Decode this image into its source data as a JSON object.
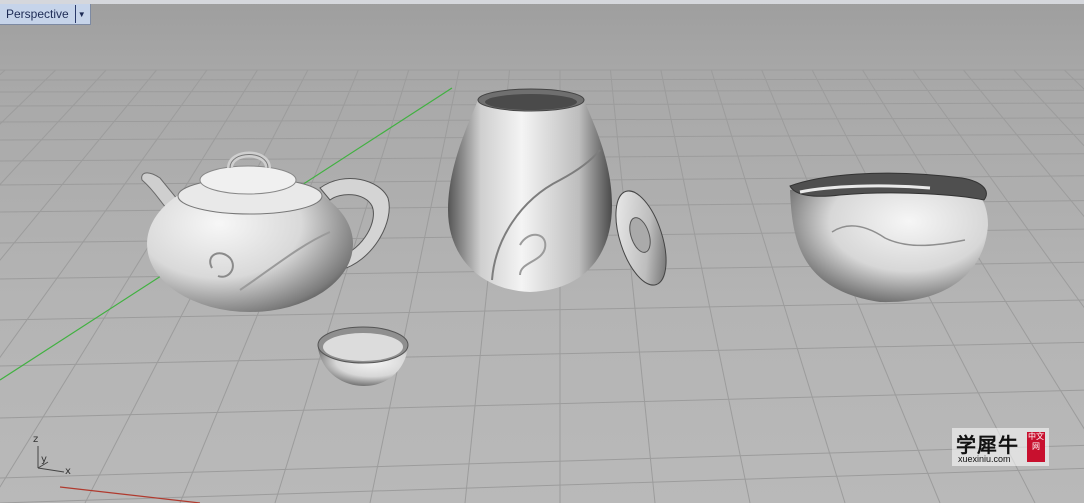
{
  "viewport": {
    "title": "Perspective",
    "menu_icon": "triangle-down-icon"
  },
  "axes": {
    "z_label": "z",
    "y_label": "y",
    "x_label": "x"
  },
  "objects": [
    "teapot",
    "tea-canister",
    "canister-lid",
    "tea-cup",
    "fair-cup-pitcher"
  ],
  "watermark": {
    "main_text": "学犀牛",
    "sub_text": "xuexiniu.com",
    "seal_text": "中文网"
  },
  "colors": {
    "grid_line": "#9a9a9a",
    "x_axis": "#c0392b",
    "y_axis": "#3fae3f",
    "tab_bg": "#c6d4ea"
  }
}
